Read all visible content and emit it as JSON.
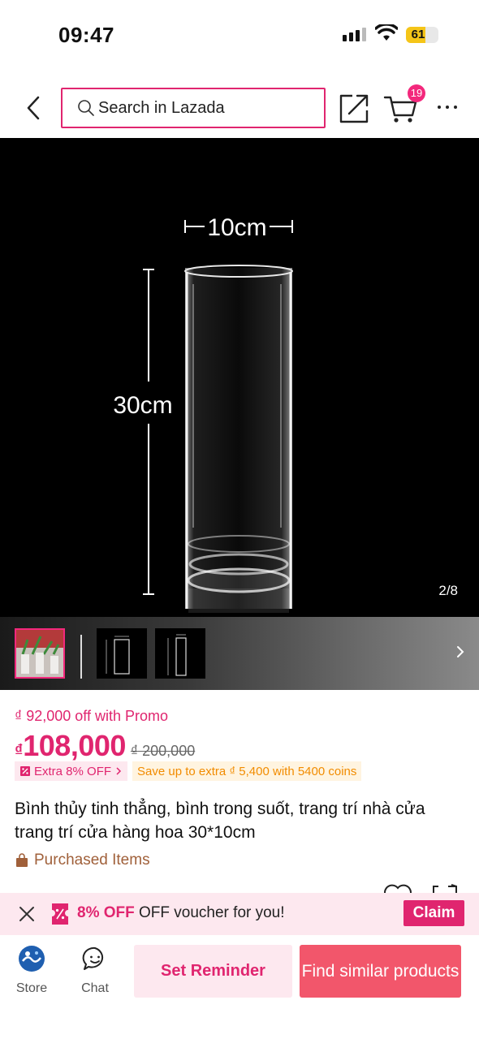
{
  "status_bar": {
    "time": "09:47",
    "battery": "61",
    "battery_level": 0.61
  },
  "header": {
    "search_placeholder": "Search in Lazada",
    "cart_count": "19"
  },
  "gallery": {
    "counter": "2/8",
    "image_labels": {
      "width": "10cm",
      "height": "30cm"
    },
    "thumbnails": [
      "thumb-1",
      "thumb-2",
      "thumb-3"
    ]
  },
  "product": {
    "promo_text": "₫ 92,000 off with Promo",
    "currency": "₫",
    "price": "108,000",
    "old_price": "₫ 200,000",
    "extra_badge": "Extra 8% OFF",
    "coins_badge": "Save up to extra ₫ 5,400 with 5400 coins",
    "title": "Bình thủy tinh thẳng, bình trong suốt, trang trí nhà cửa trang trí cửa hàng hoa 30*10cm",
    "purchased_label": "Purchased Items"
  },
  "voucher": {
    "highlight": "8% OFF",
    "message": "OFF voucher for you!",
    "claim_label": "Claim"
  },
  "bottom_bar": {
    "store_label": "Store",
    "chat_label": "Chat",
    "reminder_label": "Set Reminder",
    "similar_label": "Find similar products"
  },
  "colors": {
    "brand": "#e0256f",
    "brand_light": "#fde8ef",
    "similar_button": "#f2566b",
    "coins": "#f28c00"
  }
}
